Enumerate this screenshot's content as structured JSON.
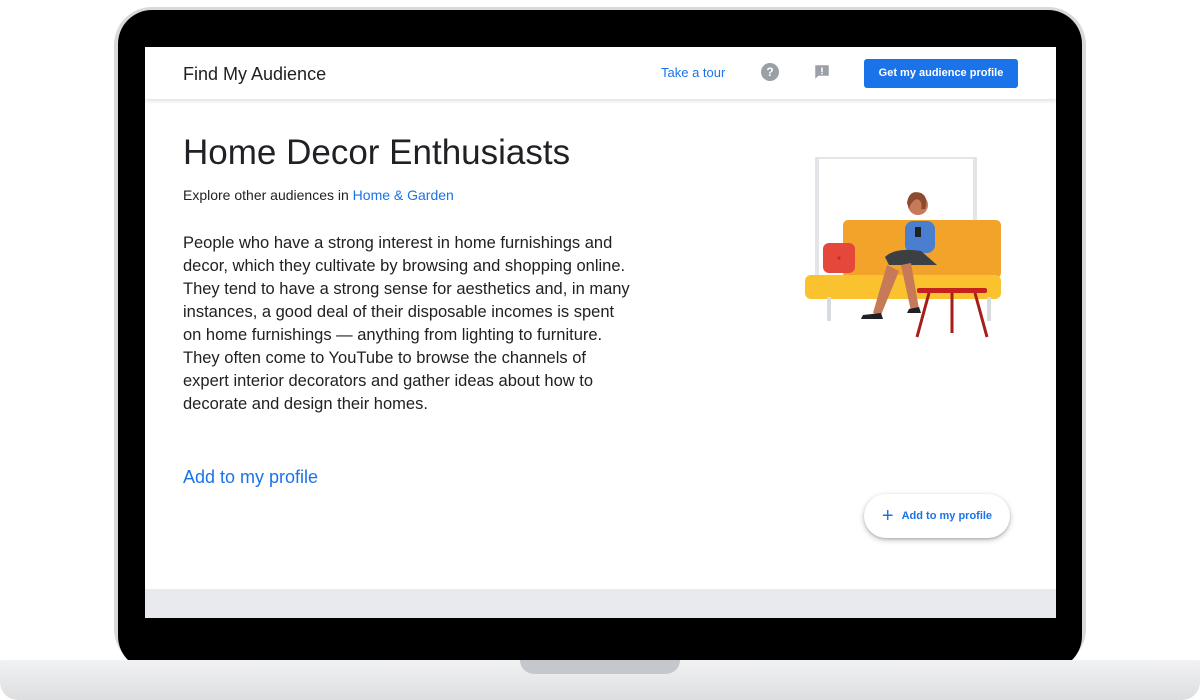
{
  "header": {
    "app_title": "Find My Audience",
    "tour_label": "Take a tour",
    "help_icon": "help-icon",
    "feedback_icon": "feedback-icon",
    "cta_label": "Get my audience profile"
  },
  "main": {
    "title": "Home Decor Enthusiasts",
    "explore_prefix": "Explore other audiences in",
    "explore_link": "Home & Garden",
    "description": "People who have a strong interest in home furnishings and decor, which they cultivate by browsing and shopping online. They tend to have a strong sense for aesthetics and, in many instances, a good deal of their disposable incomes is spent on home furnishings — anything from lighting to furniture. They often come to YouTube to browse the channels of expert interior decorators and gather ideas about how to decorate and design their homes.",
    "add_link_label": "Add to my profile",
    "fab_label": "Add to my profile",
    "fab_icon": "plus-icon"
  },
  "colors": {
    "accent": "#1a73e8",
    "text": "#202124",
    "sofa": "#f9c22e",
    "table": "#c5221f"
  }
}
